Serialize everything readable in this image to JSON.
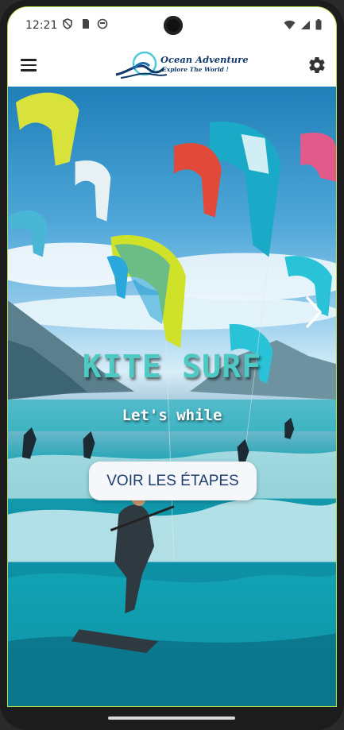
{
  "status_bar": {
    "time": "12:21",
    "left_icons": [
      "shield-icon",
      "sim-card-icon",
      "face-icon"
    ],
    "right_icons": [
      "wifi-icon",
      "signal-icon",
      "battery-icon"
    ]
  },
  "app_bar": {
    "menu_icon": "hamburger-menu-icon",
    "logo_title": "Ocean Adventure",
    "logo_subtitle": "Explore The World !",
    "settings_icon": "gear-icon"
  },
  "hero": {
    "title": "KITE SURF",
    "subtitle": "Let's while",
    "cta_label": "VOIR LES ÉTAPES",
    "next_icon": "chevron-right-icon"
  },
  "colors": {
    "title": "#4ec9c3",
    "cta_text": "#1e3f6e",
    "cta_bg": "#f6f7fb",
    "screen_border": "#b8e04a"
  }
}
